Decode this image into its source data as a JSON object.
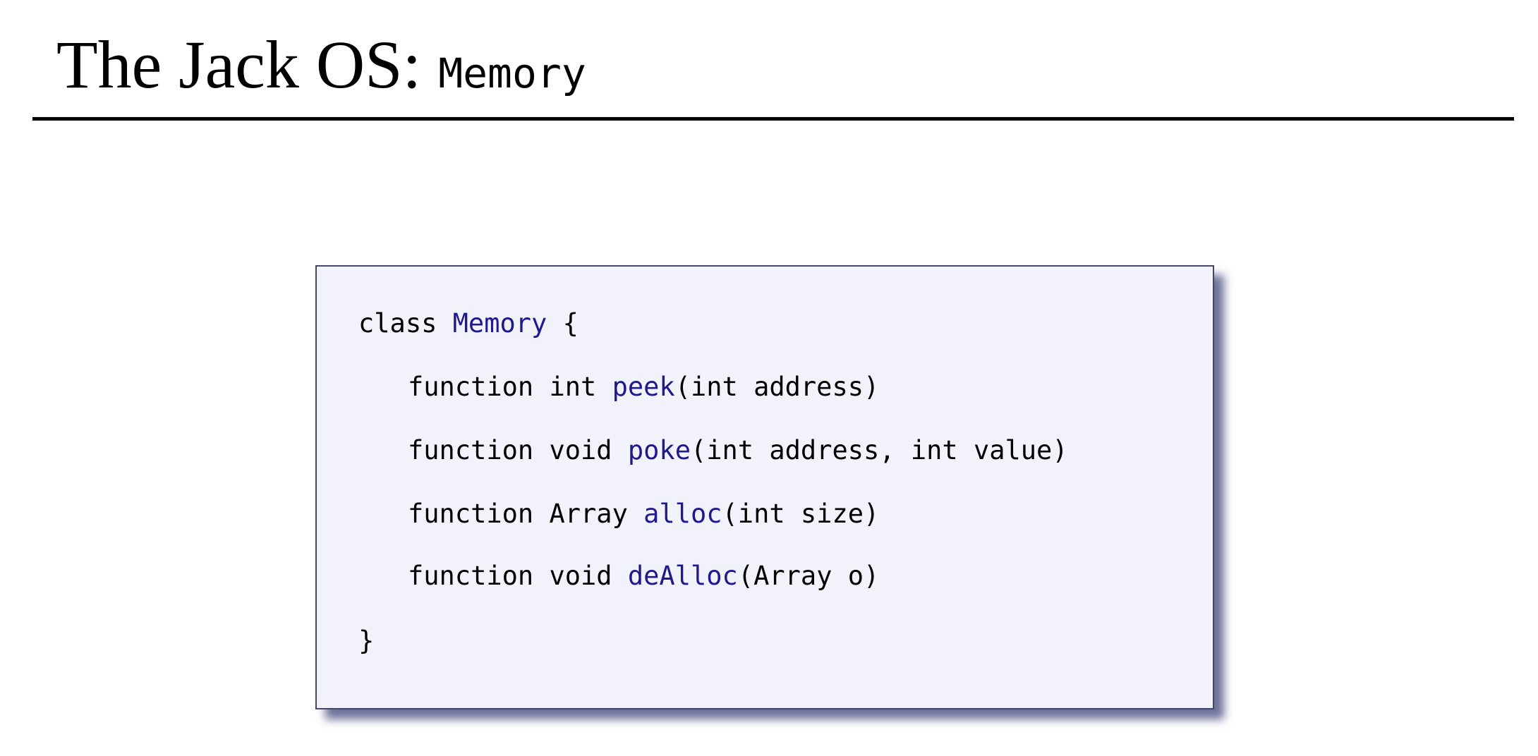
{
  "slide": {
    "title_main": "The Jack OS: ",
    "title_code": "Memory"
  },
  "code": {
    "line1": {
      "kw": "class ",
      "name": "Memory",
      "rest": " {"
    },
    "line2": {
      "prefix": "function int ",
      "name": "peek",
      "rest": "(int address)"
    },
    "line3": {
      "prefix": "function void ",
      "name": "poke",
      "rest": "(int address, int value)"
    },
    "line4": {
      "prefix": "function Array ",
      "name": "alloc",
      "rest": "(int size)"
    },
    "line5": {
      "prefix": "function void ",
      "name": "deAlloc",
      "rest": "(Array o)"
    },
    "line6": {
      "text": "}"
    }
  },
  "colors": {
    "identifier": "#1e1a8e",
    "box_background": "#f2f2fb",
    "box_border": "#44476a",
    "box_shadow": "#3e4278"
  }
}
